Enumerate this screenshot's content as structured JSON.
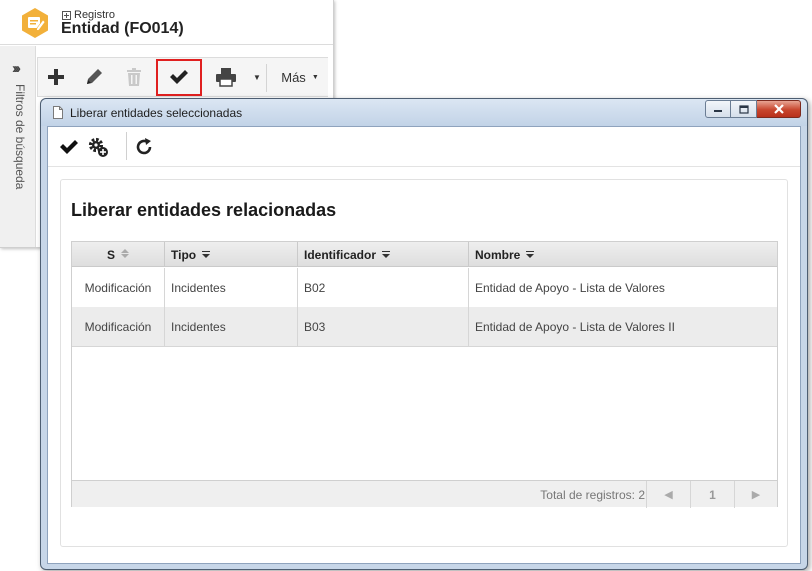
{
  "background_app": {
    "registro_label": "Registro",
    "entity_title": "Entidad (FO014)",
    "sidebar_label": "Filtros de búsqueda",
    "toolbar": {
      "more_label": "Más"
    }
  },
  "dialog": {
    "title": "Liberar entidades seleccionadas",
    "section_title": "Liberar entidades relacionadas",
    "columns": [
      "S",
      "Tipo",
      "Identificador",
      "Nombre"
    ],
    "rows": [
      {
        "s": "Modificación",
        "tipo": "Incidentes",
        "identificador": "B02",
        "nombre": "Entidad de Apoyo - Lista de Valores"
      },
      {
        "s": "Modificación",
        "tipo": "Incidentes",
        "identificador": "B03",
        "nombre": "Entidad de Apoyo - Lista de Valores II"
      }
    ],
    "footer": {
      "total_label": "Total de registros: 2",
      "page_prev": "◀",
      "page_current": "1",
      "page_next": "▶"
    }
  },
  "colors": {
    "accent_highlight": "#e02020",
    "logo_orange": "#f0a830"
  }
}
